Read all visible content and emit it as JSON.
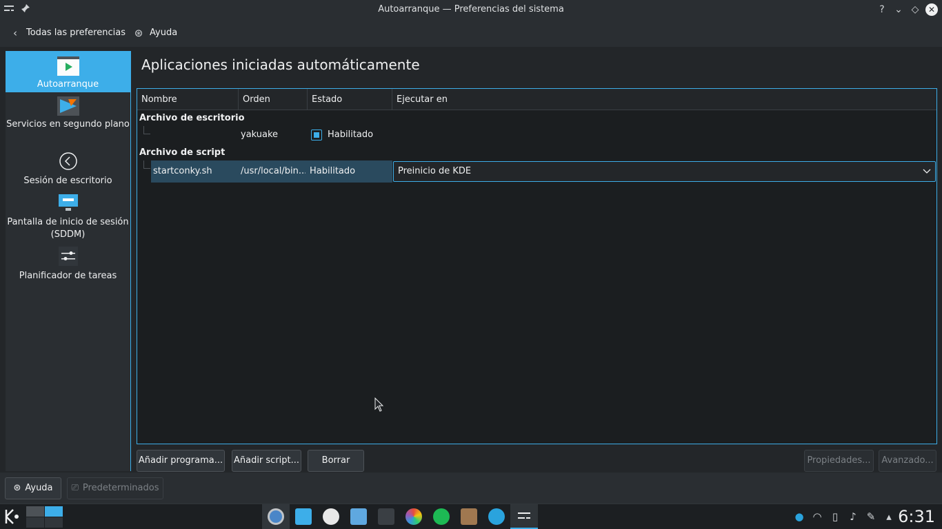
{
  "window": {
    "title": "Autoarranque — Preferencias del sistema",
    "controls": [
      "?",
      "⌄",
      "◇",
      "✕"
    ]
  },
  "toolbar": {
    "back_label": "Todas las preferencias",
    "help_label": "Ayuda"
  },
  "sidebar": {
    "items": [
      {
        "label": "Autoarranque"
      },
      {
        "label": "Servicios en segundo plano"
      },
      {
        "label": "Sesión de escritorio"
      },
      {
        "label": "Pantalla de inicio de sesión (SDDM)"
      },
      {
        "label": "Planificador de tareas"
      }
    ]
  },
  "main": {
    "title": "Aplicaciones iniciadas automáticamente",
    "columns": [
      "Nombre",
      "Orden",
      "Estado",
      "Ejecutar en"
    ],
    "groups": [
      {
        "label": "Archivo de escritorio",
        "rows": [
          {
            "name": "",
            "order": "yakuake",
            "status": "Habilitado",
            "run_at": ""
          }
        ]
      },
      {
        "label": "Archivo de script",
        "rows": [
          {
            "name": "startconky.sh",
            "order": "/usr/local/bin...",
            "status": "Habilitado",
            "run_at": "Preinicio de KDE"
          }
        ]
      }
    ],
    "buttons": {
      "add_program": "Añadir programa...",
      "add_script": "Añadir script...",
      "delete": "Borrar",
      "properties": "Propiedades...",
      "advanced": "Avanzado..."
    }
  },
  "footer": {
    "help_label": "Ayuda",
    "defaults_label": "Predeterminados"
  },
  "taskbar": {
    "clock": "6:31"
  },
  "colors": {
    "accent": "#3daee9",
    "background": "#232629",
    "panel": "#2a2e32"
  }
}
